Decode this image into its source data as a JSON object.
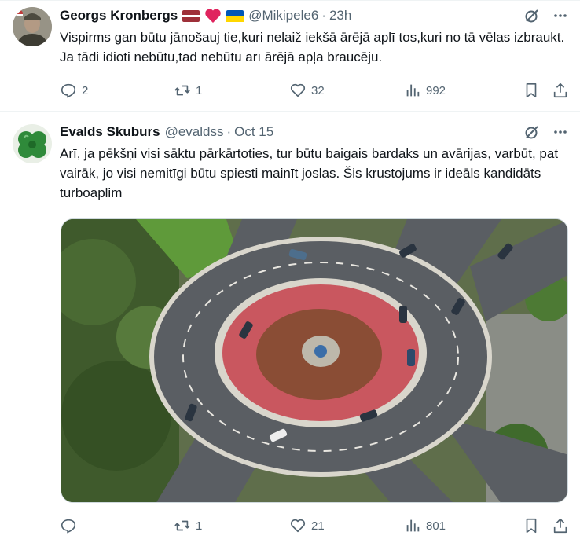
{
  "tweets": [
    {
      "name": "Georgs Kronbergs",
      "handle": "@Mikipele6",
      "dot": "·",
      "time": "23h",
      "text": "Vispirms gan būtu jānošauj tie,kuri nelaiž iekšā ārējā aplī tos,kuri no tā vēlas izbraukt. Ja tādi idioti nebūtu,tad nebūtu arī ārējā apļa braucēju.",
      "flags": [
        "latvia-flag-icon",
        "red-heart-icon",
        "ukraine-flag-icon"
      ],
      "stats": {
        "replies": "2",
        "reposts": "1",
        "likes": "32",
        "views": "992"
      }
    },
    {
      "name": "Evalds Skuburs",
      "handle": "@evaldss",
      "dot": "·",
      "time": "Oct 15",
      "text": "Arī, ja pēkšņi visi sāktu pārkārtoties, tur būtu baigais bardaks un avārijas, varbūt, pat vairāk, jo visi nemitīgi būtu spiesti mainīt joslas. Šis krustojums ir ideāls kandidāts turboaplim",
      "stats": {
        "replies": "",
        "reposts": "1",
        "likes": "21",
        "views": "801"
      },
      "media": "roundabout-aerial-photo"
    }
  ],
  "colors": {
    "text": "#0f1419",
    "secondary": "#536471",
    "border": "#eff3f4"
  }
}
